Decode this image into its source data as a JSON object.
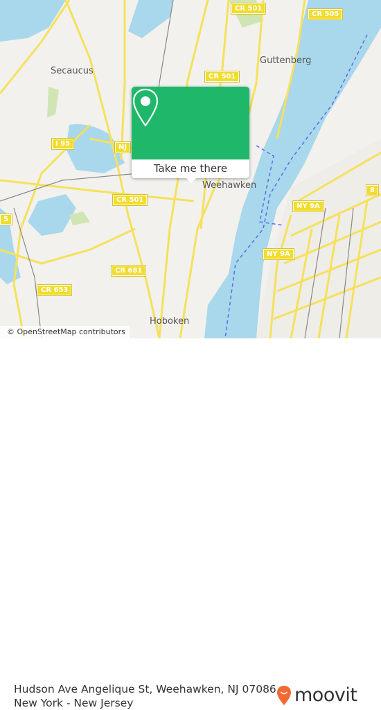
{
  "map": {
    "place_labels": {
      "secaucus": "Secaucus",
      "guttenberg": "Guttenberg",
      "weehawken": "Weehawken",
      "hoboken": "Hoboken"
    },
    "road_shields": {
      "cr501_top": "CR 501",
      "cr505": "CR 505",
      "cr501_mid": "CR 501",
      "i95": "I 95",
      "nj": "NJ",
      "cr501_low": "CR 501",
      "cr681": "CR 681",
      "cr653": "CR 653",
      "ny9a_top": "NY 9A",
      "ny9a_low": "NY 9A",
      "route8": "8",
      "route5": "5"
    },
    "attribution": "© OpenStreetMap contributors",
    "colors": {
      "land": "#f2f1ed",
      "water": "#a9d7ec",
      "road": "#f5e15c",
      "park": "#cfe6b4",
      "ferry": "#5a6fe8"
    }
  },
  "popup": {
    "icon": "location-pin-icon",
    "button_label": "Take me there",
    "color": "#1fb86a"
  },
  "footer": {
    "address_line1": "Hudson Ave Angelique St, Weehawken, NJ 07086,",
    "address_line2": "New York - New Jersey",
    "brand": "moovit",
    "brand_icon": "moovit-pin-icon",
    "brand_color": "#f26a33"
  }
}
